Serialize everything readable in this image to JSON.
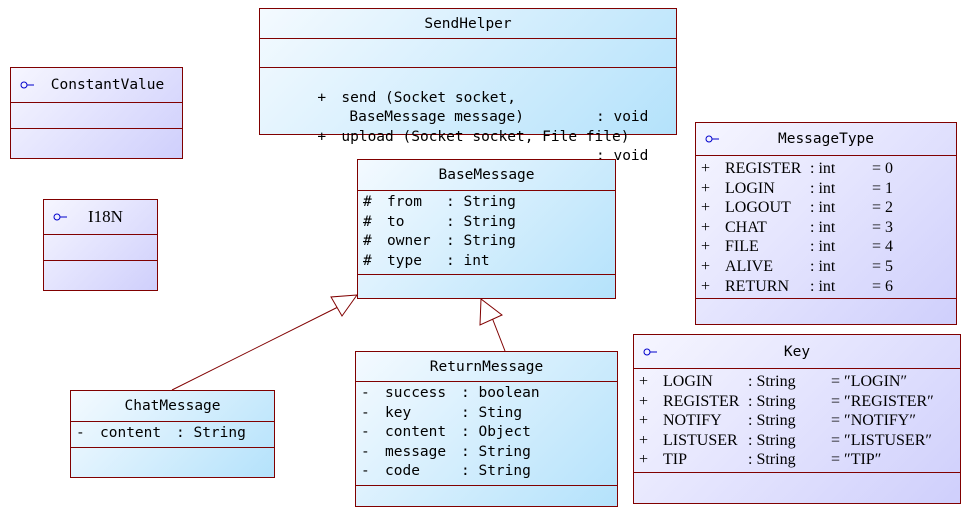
{
  "diagram_type": "UML class diagram",
  "colors": {
    "border": "#800000",
    "class_fill_light": "#f4faff",
    "class_fill_dark": "#b4e2fb",
    "interface_fill_light": "#f6f6ff",
    "interface_fill_dark": "#cfcffc",
    "interface_icon": "#0000cc"
  },
  "classes": {
    "send_helper": {
      "name": "SendHelper",
      "kind": "class",
      "attributes": [],
      "operations": [
        {
          "visibility": "+",
          "signature": "send (Socket socket,",
          "continuation": "BaseMessage message)",
          "return": ": void"
        },
        {
          "visibility": "+",
          "signature": "upload (Socket socket, File file)",
          "return": ": void"
        }
      ]
    },
    "constant_value": {
      "name": "ConstantValue",
      "kind": "interface",
      "icon": "interface-lollipop-icon",
      "attributes": [],
      "operations": []
    },
    "i18n": {
      "name": "I18N",
      "kind": "interface",
      "icon": "interface-lollipop-icon",
      "attributes": [],
      "operations": []
    },
    "base_message": {
      "name": "BaseMessage",
      "kind": "class",
      "attributes": [
        {
          "visibility": "#",
          "name": "from",
          "type": ": String"
        },
        {
          "visibility": "#",
          "name": "to",
          "type": ": String"
        },
        {
          "visibility": "#",
          "name": "owner",
          "type": ": String"
        },
        {
          "visibility": "#",
          "name": "type",
          "type": ": int"
        }
      ],
      "operations": []
    },
    "message_type": {
      "name": "MessageType",
      "kind": "interface",
      "icon": "interface-lollipop-icon",
      "attributes": [
        {
          "visibility": "+",
          "name": "REGISTER",
          "type": ": int",
          "value": "= 0"
        },
        {
          "visibility": "+",
          "name": "LOGIN",
          "type": ": int",
          "value": "= 1"
        },
        {
          "visibility": "+",
          "name": "LOGOUT",
          "type": ": int",
          "value": "= 2"
        },
        {
          "visibility": "+",
          "name": "CHAT",
          "type": ": int",
          "value": "= 3"
        },
        {
          "visibility": "+",
          "name": "FILE",
          "type": ": int",
          "value": "= 4"
        },
        {
          "visibility": "+",
          "name": "ALIVE",
          "type": ": int",
          "value": "= 5"
        },
        {
          "visibility": "+",
          "name": "RETURN",
          "type": ": int",
          "value": "= 6"
        }
      ],
      "operations": []
    },
    "key": {
      "name": "Key",
      "kind": "interface",
      "icon": "interface-lollipop-icon",
      "attributes": [
        {
          "visibility": "+",
          "name": "LOGIN",
          "type": ": String",
          "value": "= ″LOGIN″"
        },
        {
          "visibility": "+",
          "name": "REGISTER",
          "type": ": String",
          "value": "= ″REGISTER″"
        },
        {
          "visibility": "+",
          "name": "NOTIFY",
          "type": ": String",
          "value": "= ″NOTIFY″"
        },
        {
          "visibility": "+",
          "name": "LISTUSER",
          "type": ": String",
          "value": "= ″LISTUSER″"
        },
        {
          "visibility": "+",
          "name": "TIP",
          "type": ": String",
          "value": "= ″TIP″"
        }
      ],
      "operations": []
    },
    "return_message": {
      "name": "ReturnMessage",
      "kind": "class",
      "attributes": [
        {
          "visibility": "-",
          "name": "success",
          "type": ": boolean"
        },
        {
          "visibility": "-",
          "name": "key",
          "type": ": Sting"
        },
        {
          "visibility": "-",
          "name": "content",
          "type": ": Object"
        },
        {
          "visibility": "-",
          "name": "message",
          "type": ": String"
        },
        {
          "visibility": "-",
          "name": "code",
          "type": ": String"
        }
      ],
      "operations": []
    },
    "chat_message": {
      "name": "ChatMessage",
      "kind": "class",
      "attributes": [
        {
          "visibility": "-",
          "name": "content",
          "type": ": String"
        }
      ],
      "operations": []
    }
  },
  "relationships": [
    {
      "type": "generalization",
      "from": "ChatMessage",
      "to": "BaseMessage"
    },
    {
      "type": "generalization",
      "from": "ReturnMessage",
      "to": "BaseMessage"
    }
  ]
}
